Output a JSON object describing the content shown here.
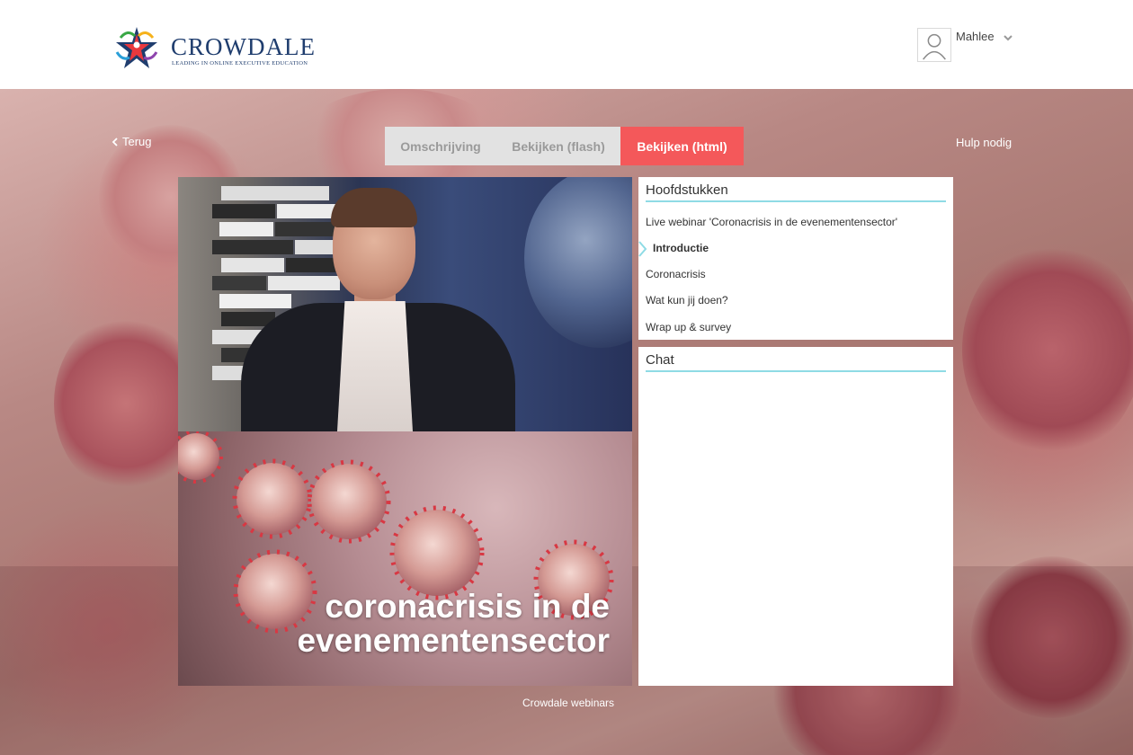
{
  "brand": {
    "name": "CROWDALE",
    "tagline": "Leading in Online Executive Education"
  },
  "user": {
    "name": "Mahlee"
  },
  "nav": {
    "back_label": "Terug",
    "help_label": "Hulp nodig"
  },
  "tabs": [
    {
      "label": "Omschrijving",
      "active": false
    },
    {
      "label": "Bekijken (flash)",
      "active": false
    },
    {
      "label": "Bekijken (html)",
      "active": true
    }
  ],
  "video": {
    "caption_line1": "coronacrisis in de",
    "caption_line2": "evenementensector"
  },
  "chapters": {
    "title": "Hoofdstukken",
    "items": [
      {
        "label": "Live webinar 'Coronacrisis in de evenementensector'",
        "current": false
      },
      {
        "label": "Introductie",
        "current": true
      },
      {
        "label": "Coronacrisis",
        "current": false
      },
      {
        "label": "Wat kun jij doen?",
        "current": false
      },
      {
        "label": "Wrap up & survey",
        "current": false
      }
    ]
  },
  "chat": {
    "title": "Chat"
  },
  "footer": {
    "label": "Crowdale webinars"
  },
  "colors": {
    "accent": "#f4585a",
    "rule": "#8fdbe5",
    "brand_navy": "#1f3d6e"
  }
}
